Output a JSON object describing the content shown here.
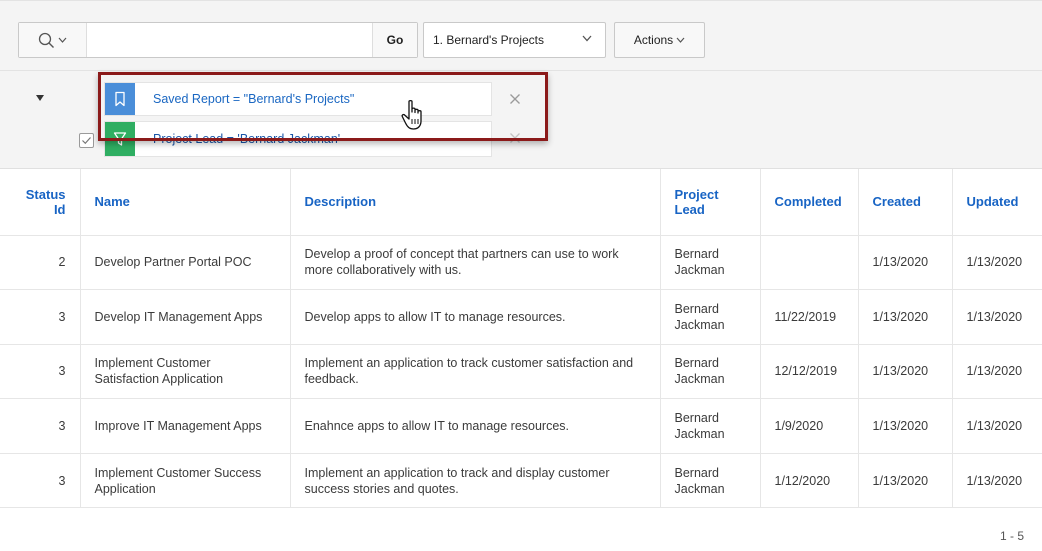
{
  "toolbar": {
    "search_placeholder": "",
    "go_label": "Go",
    "report_select": "1. Bernard's Projects",
    "actions_label": "Actions"
  },
  "filters": [
    {
      "label": "Saved Report = \"Bernard's Projects\"",
      "type": "saved-report",
      "color": "#4a8ed9"
    },
    {
      "label": "Project Lead = 'Bernard Jackman'",
      "type": "filter",
      "color": "#2fae62"
    }
  ],
  "table": {
    "columns": [
      "Status Id",
      "Name",
      "Description",
      "Project Lead",
      "Completed",
      "Created",
      "Updated"
    ],
    "rows": [
      [
        "2",
        "Develop Partner Portal POC",
        "Develop a proof of concept that partners can use to work more collaboratively with us.",
        "Bernard Jackman",
        "",
        "1/13/2020",
        "1/13/2020"
      ],
      [
        "3",
        "Develop IT Management Apps",
        "Develop apps to allow IT to manage resources.",
        "Bernard Jackman",
        "11/22/2019",
        "1/13/2020",
        "1/13/2020"
      ],
      [
        "3",
        "Implement Customer Satisfaction Application",
        "Implement an application to track customer satisfaction and feedback.",
        "Bernard Jackman",
        "12/12/2019",
        "1/13/2020",
        "1/13/2020"
      ],
      [
        "3",
        "Improve IT Management Apps",
        "Enahnce apps to allow IT to manage resources.",
        "Bernard Jackman",
        "1/9/2020",
        "1/13/2020",
        "1/13/2020"
      ],
      [
        "3",
        "Implement Customer Success Application",
        "Implement an application to track and display customer success stories and quotes.",
        "Bernard Jackman",
        "1/12/2020",
        "1/13/2020",
        "1/13/2020"
      ]
    ]
  },
  "pagination": "1 - 5",
  "colors": {
    "accent": "#1864c4",
    "highlight": "#8b1a1a"
  }
}
